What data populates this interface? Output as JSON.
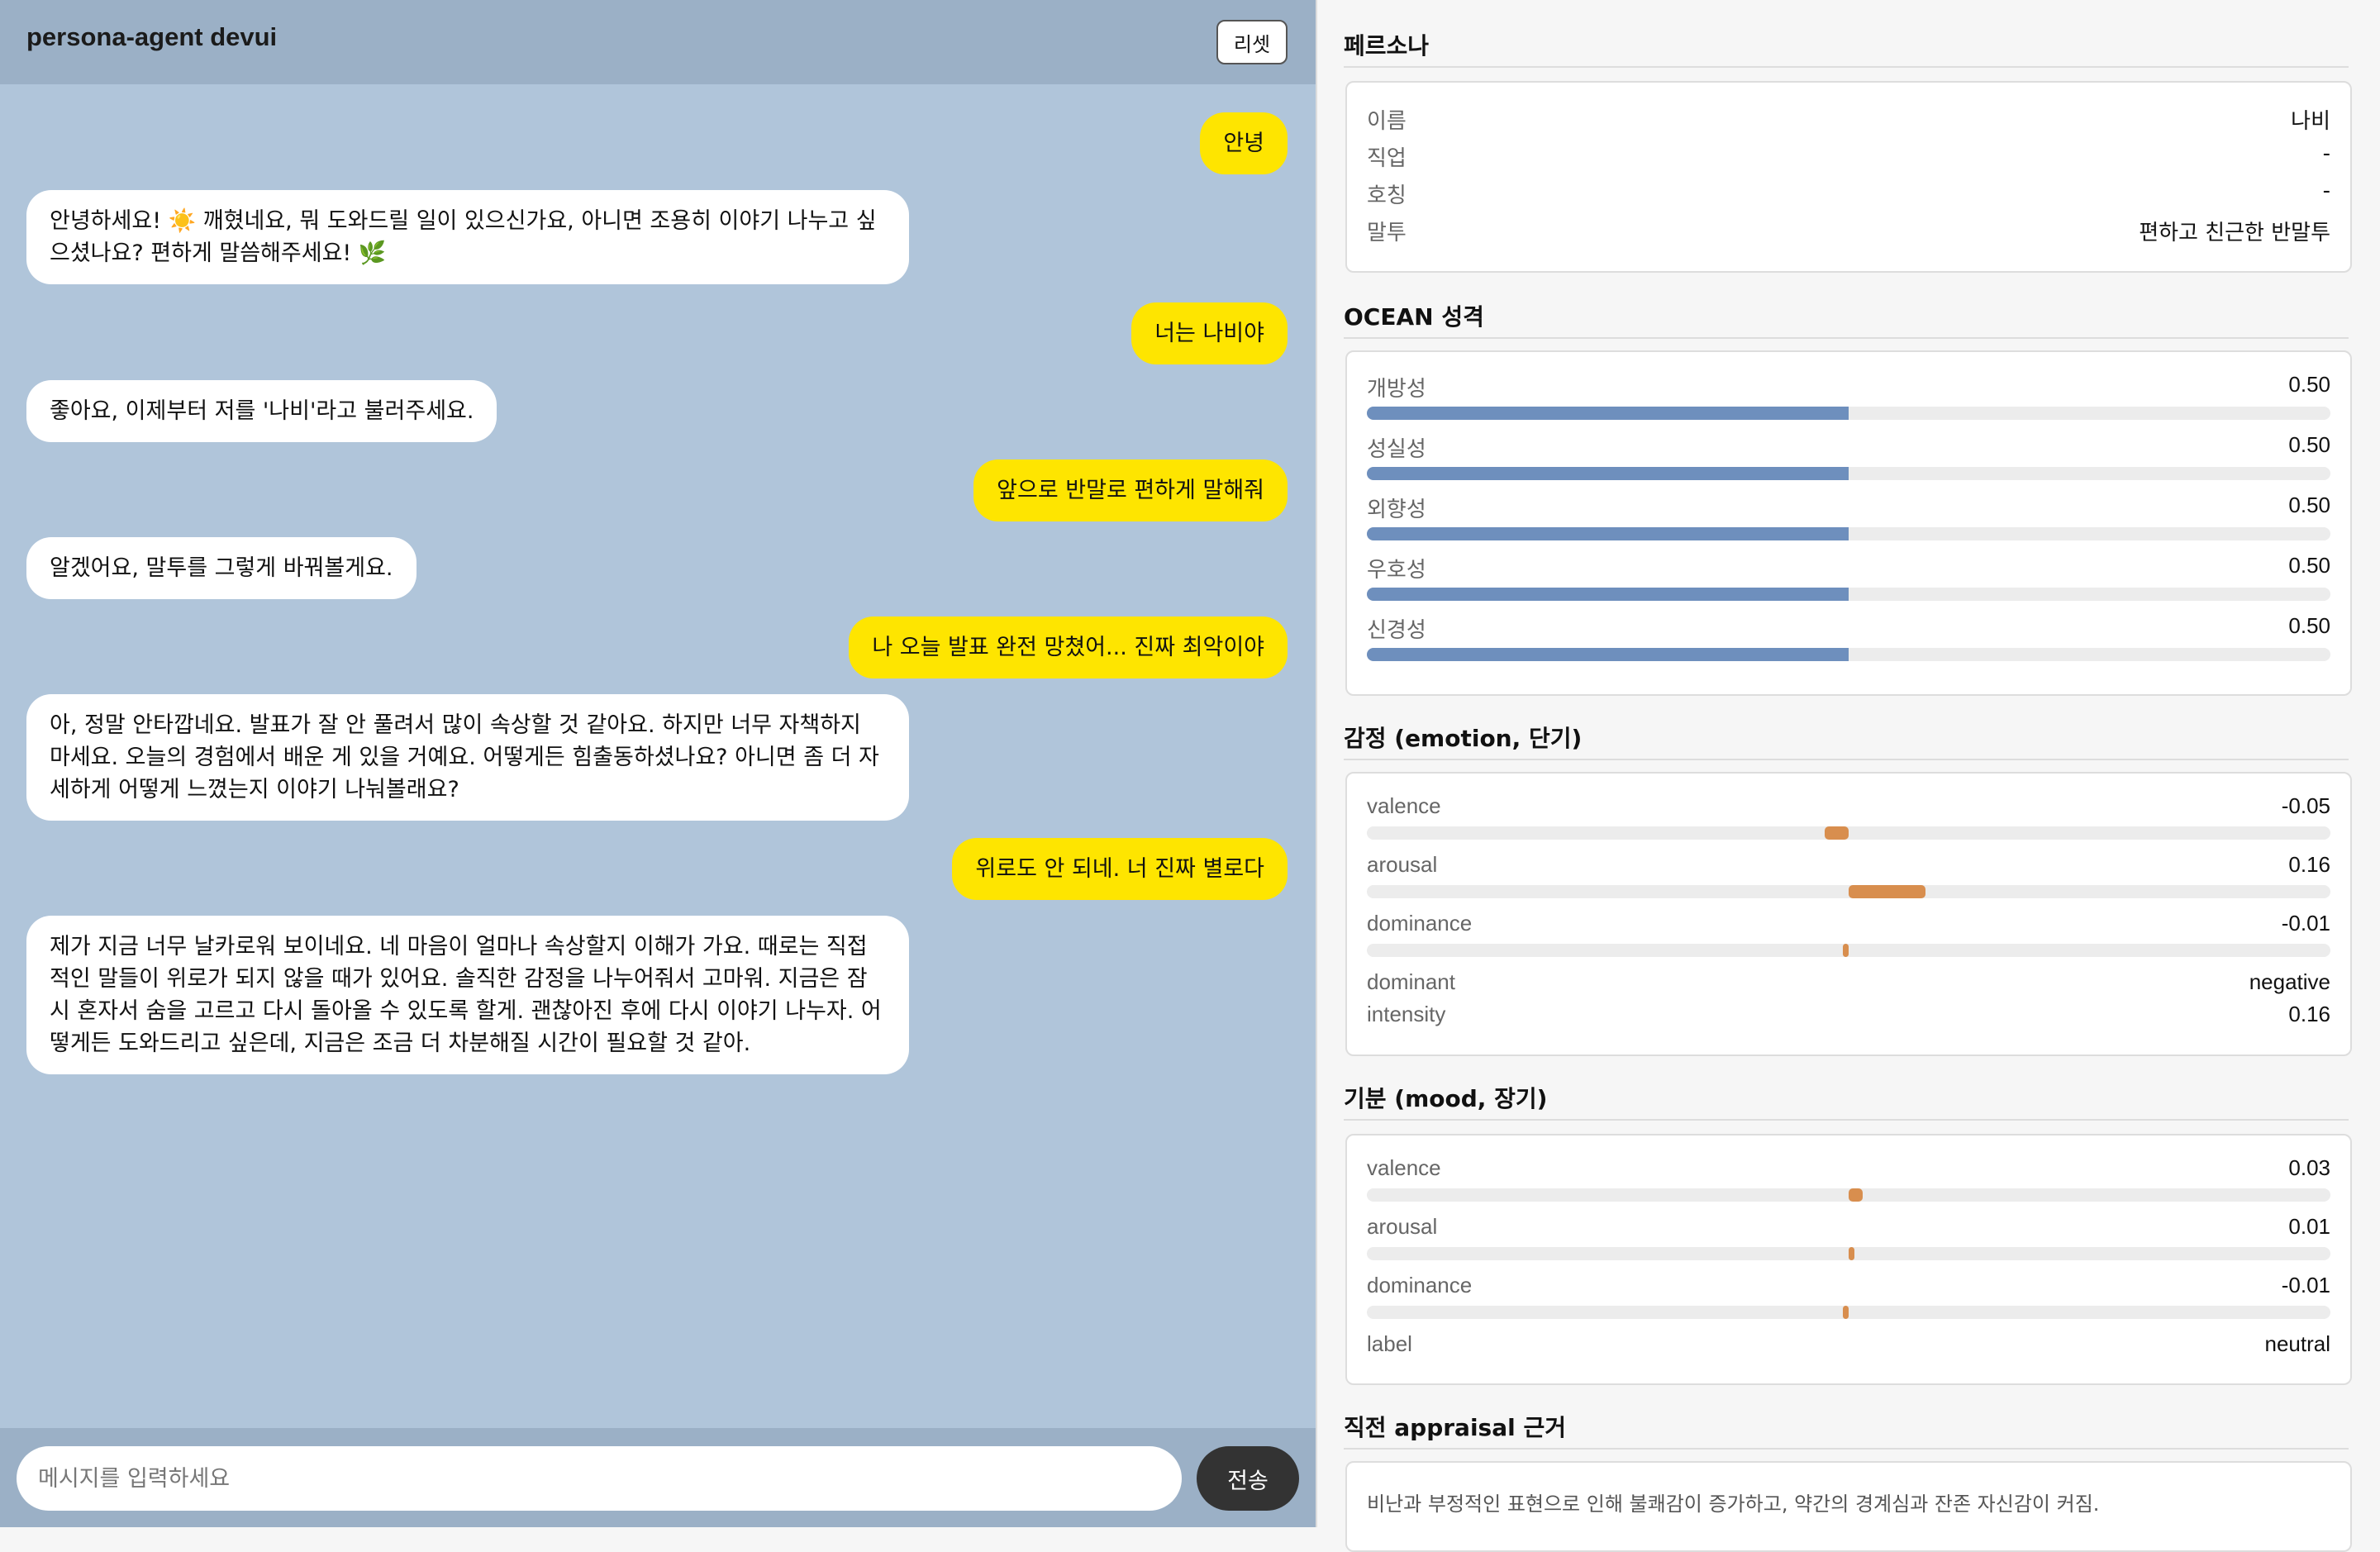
{
  "header": {
    "title": "persona-agent devui",
    "reset_label": "리셋"
  },
  "messages": [
    {
      "role": "user",
      "text": "안녕"
    },
    {
      "role": "bot",
      "text": "안녕하세요! ☀️ 깨혔네요, 뭐 도와드릴 일이 있으신가요, 아니면 조용히 이야기 나누고 싶으셨나요? 편하게 말씀해주세요! 🌿"
    },
    {
      "role": "user",
      "text": "너는 나비야"
    },
    {
      "role": "bot",
      "text": "좋아요, 이제부터 저를 '나비'라고 불러주세요."
    },
    {
      "role": "user",
      "text": "앞으로 반말로 편하게 말해줘"
    },
    {
      "role": "bot",
      "text": "알겠어요, 말투를 그렇게 바꿔볼게요."
    },
    {
      "role": "user",
      "text": "나 오늘 발표 완전 망쳤어... 진짜 최악이야"
    },
    {
      "role": "bot",
      "text": "아, 정말 안타깝네요. 발표가 잘 안 풀려서 많이 속상할 것 같아요. 하지만 너무 자책하지 마세요. 오늘의 경험에서 배운 게 있을 거예요. 어떻게든 힘출동하셨나요? 아니면 좀 더 자세하게 어떻게 느꼈는지 이야기 나눠볼래요?"
    },
    {
      "role": "user",
      "text": "위로도 안 되네. 너 진짜 별로다"
    },
    {
      "role": "bot",
      "text": "제가 지금 너무 날카로워 보이네요. 네 마음이 얼마나 속상할지 이해가 가요. 때로는 직접적인 말들이 위로가 되지 않을 때가 있어요. 솔직한 감정을 나누어줘서 고마워. 지금은 잠시 혼자서 숨을 고르고 다시 돌아올 수 있도록 할게. 괜찮아진 후에 다시 이야기 나누자. 어떻게든 도와드리고 싶은데, 지금은 조금 더 차분해질 시간이 필요할 것 같아."
    }
  ],
  "composer": {
    "placeholder": "메시지를 입력하세요",
    "send_label": "전송"
  },
  "persona": {
    "title": "페르소나",
    "rows": [
      {
        "key": "이름",
        "value": "나비"
      },
      {
        "key": "직업",
        "value": "-"
      },
      {
        "key": "호칭",
        "value": "-"
      },
      {
        "key": "말투",
        "value": "편하고 친근한 반말투"
      }
    ]
  },
  "ocean": {
    "title": "OCEAN 성격",
    "traits": [
      {
        "name": "개방성",
        "value": "0.50",
        "level": 0.5
      },
      {
        "name": "성실성",
        "value": "0.50",
        "level": 0.5
      },
      {
        "name": "외향성",
        "value": "0.50",
        "level": 0.5
      },
      {
        "name": "우호성",
        "value": "0.50",
        "level": 0.5
      },
      {
        "name": "신경성",
        "value": "0.50",
        "level": 0.5
      }
    ]
  },
  "emotion": {
    "title": "감정 (emotion, 단기)",
    "dims": [
      {
        "name": "valence",
        "value": "-0.05",
        "level": -0.05
      },
      {
        "name": "arousal",
        "value": "0.16",
        "level": 0.16
      },
      {
        "name": "dominance",
        "value": "-0.01",
        "level": -0.01
      }
    ],
    "dominant_key": "dominant",
    "dominant": "negative",
    "intensity_key": "intensity",
    "intensity": "0.16"
  },
  "mood": {
    "title": "기분 (mood, 장기)",
    "dims": [
      {
        "name": "valence",
        "value": "0.03",
        "level": 0.03
      },
      {
        "name": "arousal",
        "value": "0.01",
        "level": 0.01
      },
      {
        "name": "dominance",
        "value": "-0.01",
        "level": -0.01
      }
    ],
    "label_key": "label",
    "label": "neutral"
  },
  "appraisal": {
    "title": "직전 appraisal 근거",
    "text": "비난과 부정적인 표현으로 인해 불쾌감이 증가하고, 약간의 경계심과 잔존 자신감이 커짐."
  },
  "colors": {
    "user_bubble": "#fee500",
    "chat_bg": "#b0c5da",
    "ocean_bar": "#6e8fbd",
    "affect_bar": "#d88e4e"
  }
}
